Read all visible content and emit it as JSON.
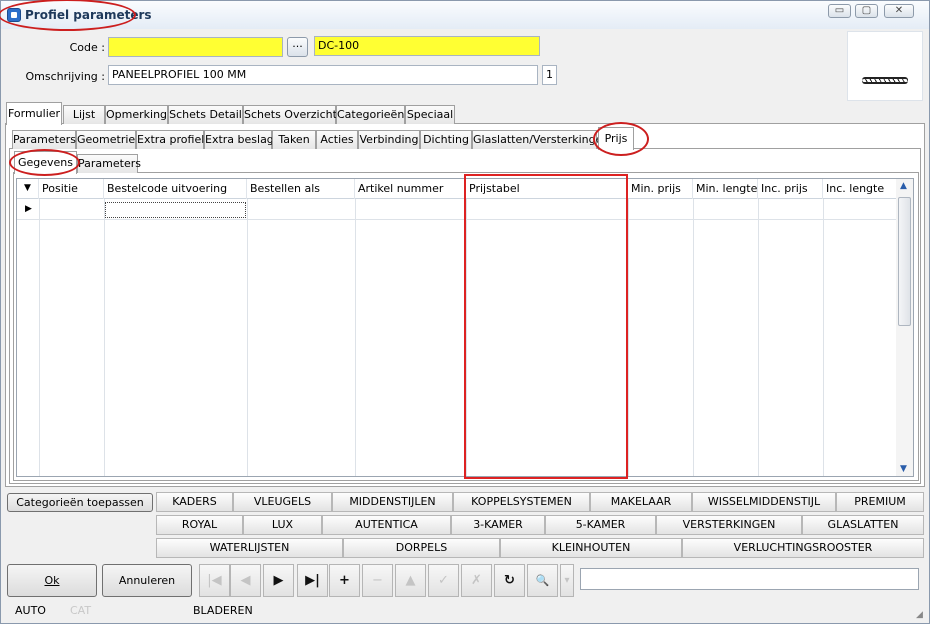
{
  "window": {
    "title": "Profiel parameters"
  },
  "window_controls": {
    "minimize": "▭",
    "maximize": "▢",
    "close": "✕"
  },
  "form": {
    "code_label": "Code :",
    "code_value": "",
    "ellipsis_label": "...",
    "code_name": "DC-100",
    "description_label": "Omschrijving :",
    "description_value": "PANEELPROFIEL 100 MM",
    "count": "1"
  },
  "main_tabs": [
    "Formulier",
    "Lijst",
    "Opmerking",
    "Schets Detail",
    "Schets Overzicht",
    "Categorieën",
    "Speciaal"
  ],
  "sub_tabs": [
    "Parameters",
    "Geometrie",
    "Extra profiel",
    "Extra beslag",
    "Taken",
    "Acties",
    "Verbinding",
    "Dichting",
    "Glaslatten/Versterkingen",
    "Prijs"
  ],
  "inner_tabs": [
    "Gegevens",
    "Parameters"
  ],
  "grid": {
    "columns": [
      "Positie",
      "Bestelcode uitvoering",
      "Bestellen als",
      "Artikel nummer",
      "Prijstabel",
      "Min. prijs",
      "Min. lengte",
      "Inc. prijs",
      "Inc. lengte"
    ]
  },
  "categories": {
    "apply_label": "Categorieën toepassen",
    "row1": [
      "KADERS",
      "VLEUGELS",
      "MIDDENSTIJLEN",
      "KOPPELSYSTEMEN",
      "MAKELAAR",
      "WISSELMIDDENSTIJL",
      "PREMIUM"
    ],
    "row2": [
      "ROYAL",
      "LUX",
      "AUTENTICA",
      "3-KAMER",
      "5-KAMER",
      "VERSTERKINGEN",
      "GLASLATTEN"
    ],
    "row3": [
      "WATERLIJSTEN",
      "DORPELS",
      "KLEINHOUTEN",
      "VERLUCHTINGSROOSTER"
    ]
  },
  "buttons": {
    "ok": "Ok",
    "cancel": "Annuleren"
  },
  "navigator": {
    "first": "|◀",
    "prev": "◀",
    "next": "▶",
    "last": "▶|",
    "insert": "+",
    "delete": "−",
    "edit": "▲",
    "post": "✓",
    "cancel": "✗",
    "refresh": "↻",
    "find": "🔍",
    "more": "▾"
  },
  "status": {
    "mode": "AUTO",
    "cat": "CAT",
    "state": "BLADEREN"
  }
}
